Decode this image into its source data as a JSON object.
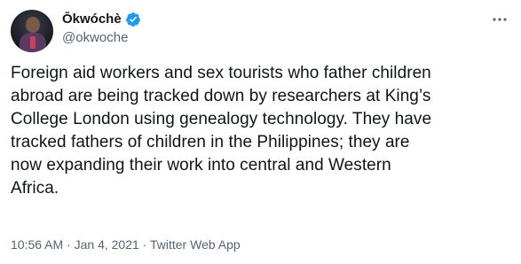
{
  "user": {
    "display_name": "Ōkwóchè",
    "handle": "@okwoche",
    "verified": true
  },
  "tweet": {
    "lines": [
      "Foreign aid workers and sex tourists who father children",
      "abroad are being tracked down by researchers at King’s",
      "College London using genealogy technology. They have",
      "tracked fathers of children in the Philippines; they are",
      "now expanding their work into central and Western",
      "Africa."
    ]
  },
  "meta": {
    "time": "10:56 AM",
    "separator": " · ",
    "date": "Jan 4, 2021",
    "source": "Twitter Web App"
  },
  "colors": {
    "verified_badge": "#1d9bf0",
    "secondary_text": "#536471",
    "primary_text": "#0f1419"
  },
  "icons": {
    "verified": "verified-badge-icon",
    "more": "more-dots-icon"
  }
}
